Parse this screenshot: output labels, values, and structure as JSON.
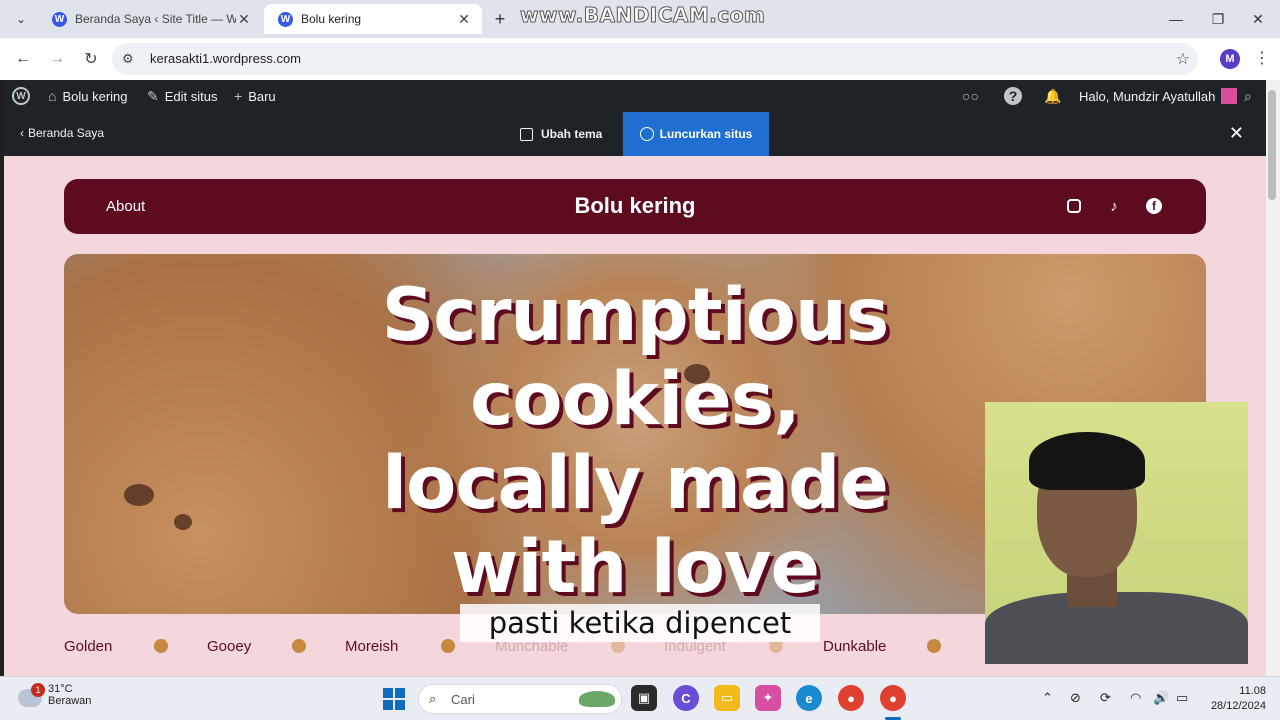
{
  "browser": {
    "tabs": [
      {
        "title": "Beranda Saya ‹ Site Title — Wo",
        "active": false
      },
      {
        "title": "Bolu kering",
        "active": true
      }
    ],
    "watermark": "www.BANDICAM.com",
    "url": "kerasakti1.wordpress.com",
    "profile_initial": "M"
  },
  "wp_admin_bar": {
    "site_name": "Bolu kering",
    "edit_site": "Edit situs",
    "new": "Baru",
    "greeting": "Halo, Mundzir Ayatullah"
  },
  "editor_bar": {
    "back": "Beranda Saya",
    "change_theme": "Ubah tema",
    "launch": "Luncurkan situs"
  },
  "site": {
    "nav_about": "About",
    "title": "Bolu kering",
    "hero_headline": "Scrumptious cookies, locally made with love",
    "marquee": [
      "Golden",
      "Gooey",
      "Moreish",
      "Munchable",
      "Indulgent",
      "Dunkable"
    ],
    "accent_color": "#5e0b1f",
    "background_color": "#f4d7dc"
  },
  "subtitle_caption": "pasti ketika dipencet",
  "taskbar": {
    "temperature": "31°C",
    "weather": "Berawan",
    "weather_badge": "1",
    "search_placeholder": "Cari",
    "time": "11.08",
    "date": "28/12/2024"
  }
}
